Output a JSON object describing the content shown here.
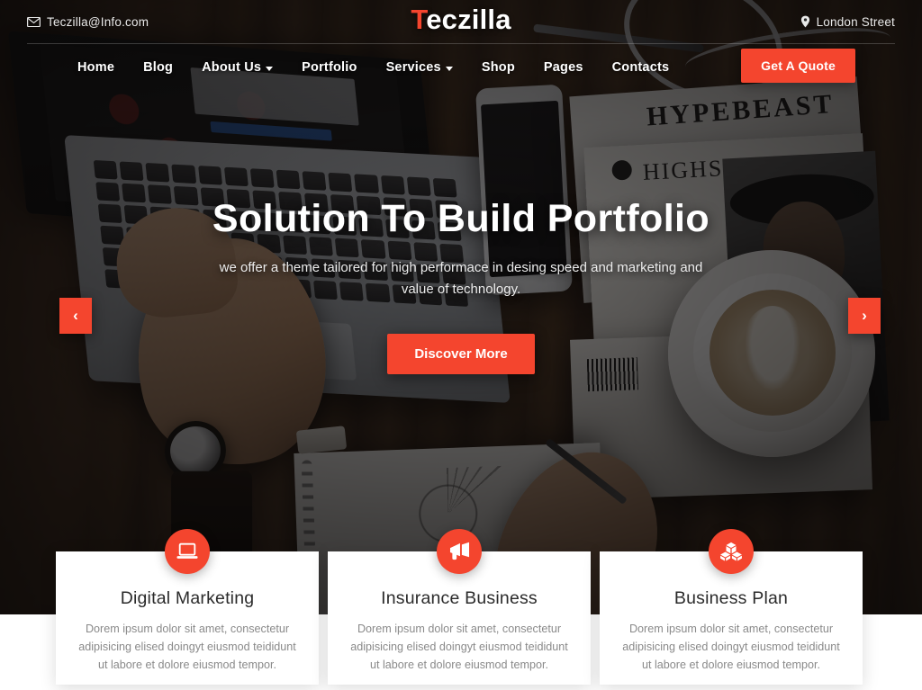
{
  "topbar": {
    "email": "Teczilla@Info.com",
    "email_icon": "envelope-icon",
    "location": "London Street",
    "location_icon": "map-pin-icon"
  },
  "brand": {
    "first_letter": "T",
    "rest": "eczilla",
    "full": "Teczilla",
    "accent_color": "#f4452e"
  },
  "nav": {
    "items": [
      {
        "label": "Home",
        "has_dropdown": false
      },
      {
        "label": "Blog",
        "has_dropdown": false
      },
      {
        "label": "About Us",
        "has_dropdown": true
      },
      {
        "label": "Portfolio",
        "has_dropdown": false
      },
      {
        "label": "Services",
        "has_dropdown": true
      },
      {
        "label": "Shop",
        "has_dropdown": false
      },
      {
        "label": "Pages",
        "has_dropdown": false
      },
      {
        "label": "Contacts",
        "has_dropdown": false
      }
    ],
    "cta_label": "Get A Quote"
  },
  "hero": {
    "title": "Solution To Build Portfolio",
    "subtitle": "we offer a theme tailored for high performace in desing speed and marketing and value of technology.",
    "button_label": "Discover More",
    "prev_label": "‹",
    "next_label": "›",
    "background_texts": {
      "magazine_one": "HYPEBEAST",
      "magazine_two": "HIGHSNOBIETY"
    }
  },
  "services": {
    "cards": [
      {
        "icon": "laptop-icon",
        "title": "Digital Marketing",
        "text": "Dorem ipsum dolor sit amet, consectetur adipisicing elised doingyt eiusmod teididunt ut labore et dolore eiusmod tempor."
      },
      {
        "icon": "megaphone-icon",
        "title": "Insurance Business",
        "text": "Dorem ipsum dolor sit amet, consectetur adipisicing elised doingyt eiusmod teididunt ut labore et dolore eiusmod tempor."
      },
      {
        "icon": "cubes-icon",
        "title": "Business Plan",
        "text": "Dorem ipsum dolor sit amet, consectetur adipisicing elised doingyt eiusmod teididunt ut labore et dolore eiusmod tempor."
      }
    ]
  },
  "colors": {
    "accent": "#f4452e",
    "card_bg": "#ffffff",
    "heading": "#2b2b2b",
    "body_text": "#8a8a8a"
  }
}
